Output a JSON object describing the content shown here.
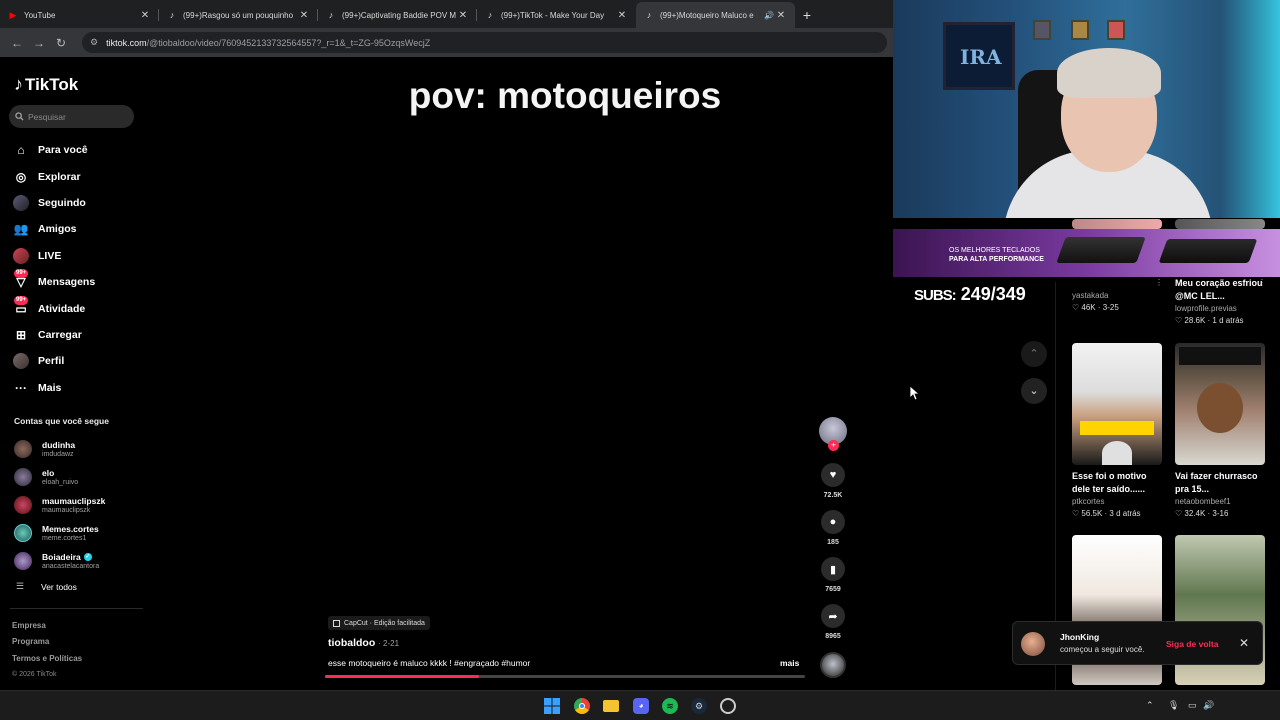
{
  "browser": {
    "tabs": [
      {
        "title": "YouTube",
        "favicon": "youtube-icon",
        "active": false
      },
      {
        "title": "(99+)Rasgou só um pouquinho",
        "favicon": "tiktok-icon",
        "active": false
      },
      {
        "title": "(99+)Captivating Baddie POV M",
        "favicon": "tiktok-icon",
        "active": false
      },
      {
        "title": "(99+)TikTok - Make Your Day",
        "favicon": "tiktok-icon",
        "active": false
      },
      {
        "title": "(99+)Motoqueiro Maluco e",
        "favicon": "tiktok-icon",
        "active": true
      }
    ],
    "url_host": "tiktok.com",
    "url_path": "/@tiobaldoo/video/7609452133732564557?_r=1&_t=ZG-95OzqsWecjZ"
  },
  "tiktok": {
    "logo": "TikTok",
    "search_placeholder": "Pesquisar",
    "nav": [
      {
        "label": "Para você",
        "icon": "home-icon"
      },
      {
        "label": "Explorar",
        "icon": "compass-icon"
      },
      {
        "label": "Seguindo",
        "icon": "following-icon"
      },
      {
        "label": "Amigos",
        "icon": "friends-icon"
      },
      {
        "label": "LIVE",
        "icon": "live-icon"
      },
      {
        "label": "Mensagens",
        "icon": "messages-icon",
        "badge": "99+"
      },
      {
        "label": "Atividade",
        "icon": "activity-icon",
        "badge": "99+"
      },
      {
        "label": "Carregar",
        "icon": "upload-icon"
      },
      {
        "label": "Perfil",
        "icon": "profile-icon"
      },
      {
        "label": "Mais",
        "icon": "more-icon"
      }
    ],
    "following_title": "Contas que você segue",
    "following": [
      {
        "name": "dudinha",
        "handle": "imdudawz",
        "verified": false
      },
      {
        "name": "elo",
        "handle": "eloah_ruivo",
        "verified": false
      },
      {
        "name": "maumauclipszk",
        "handle": "maumauclipszk",
        "verified": false
      },
      {
        "name": "Memes.cortes",
        "handle": "meme.cortes1",
        "verified": false
      },
      {
        "name": "Boiadeira",
        "handle": "anacastelacantora",
        "verified": true
      }
    ],
    "see_all": "Ver todos",
    "footer": [
      "Empresa",
      "Programa",
      "Termos e Políticas"
    ],
    "copyright": "© 2026 TikTok",
    "video": {
      "overlay_text": "pov: motoqueiros",
      "capcut_label": "CapCut · Edição facilitada",
      "author": "tiobaldoo",
      "date": "· 2-21",
      "description": "esse motoqueiro é maluco kkkk ! #engraçado #humor",
      "more": "mais",
      "progress": 0.32,
      "likes": "72.5K",
      "comments": "185",
      "saves": "7659",
      "shares": "8965"
    }
  },
  "overlay": {
    "banner_line1": "OS MELHORES TECLADOS",
    "banner_line2": "PARA ALTA PERFORMANCE",
    "subs_label": "SUBS:",
    "subs_value": "249/349",
    "recs": [
      {
        "title": "",
        "user": "yastakada",
        "likes": "46K",
        "date": "3-25"
      },
      {
        "title": "Meu coração esfriou @MC LEL...",
        "user": "lowprofile.previas",
        "likes": "28.6K",
        "date": "1 d atrás"
      },
      {
        "title": "Esse foi o motivo dele ter saído......",
        "user": "ptkcortes",
        "likes": "56.5K",
        "date": "3 d atrás"
      },
      {
        "title": "Vai fazer churrasco pra 15...",
        "user": "netaobombeef1",
        "likes": "32.4K",
        "date": "3-16"
      }
    ],
    "notification": {
      "name": "JhonKing",
      "message": "começou a seguir você.",
      "cta": "Siga de volta"
    }
  },
  "colors": {
    "accent": "#fe2c55",
    "verified": "#20d5ec"
  }
}
